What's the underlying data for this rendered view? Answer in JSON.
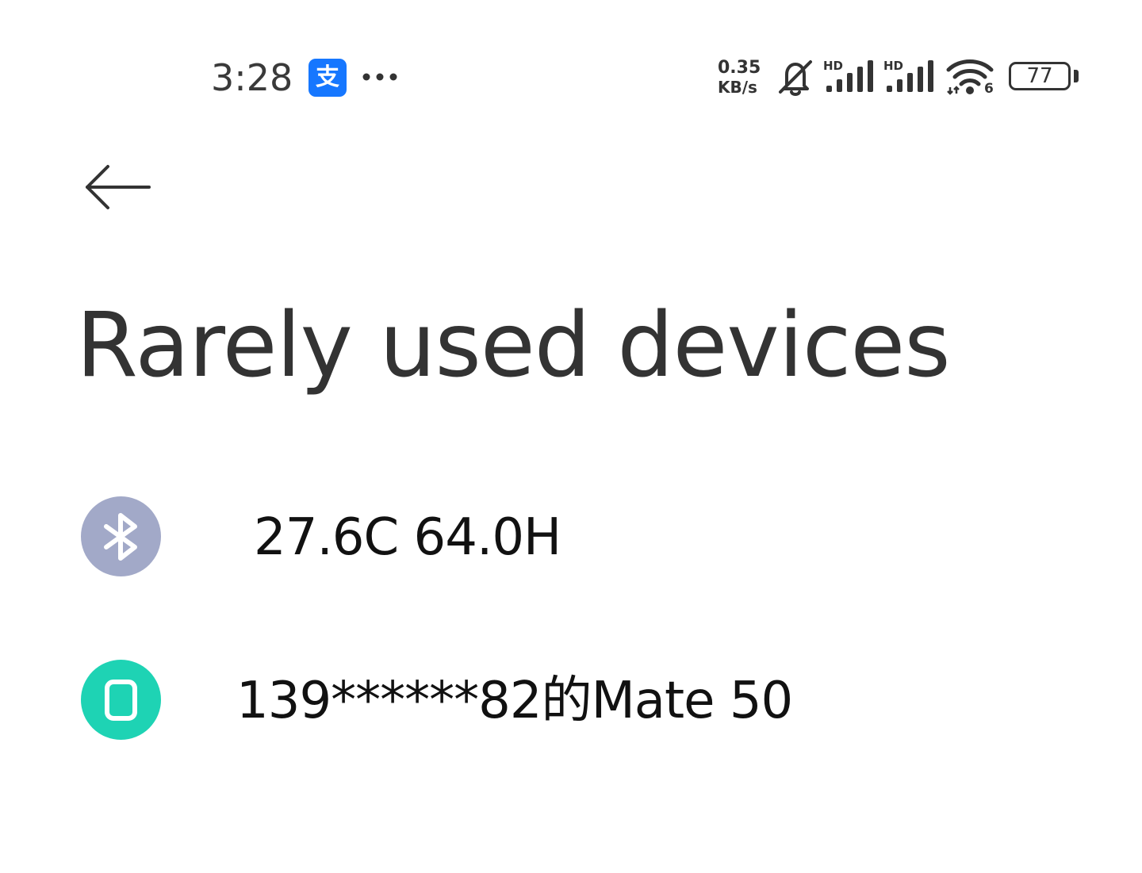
{
  "status_bar": {
    "time": "3:28",
    "notification_icons": [
      "alipay-icon",
      "more-dots-icon"
    ],
    "alipay_glyph": "支",
    "net_speed_value": "0.35",
    "net_speed_unit": "KB/s",
    "sim1_label": "HD",
    "sim2_label": "HD",
    "wifi_label": "6",
    "battery_level": "77",
    "icons": [
      "bell-muted-icon",
      "signal-icon",
      "signal-icon",
      "wifi-6-icon",
      "battery-icon"
    ]
  },
  "header": {
    "back_icon": "arrow-left-icon",
    "title": "Rarely used devices"
  },
  "devices": [
    {
      "name": "27.6C 64.0H",
      "icon": "bluetooth-icon",
      "icon_color": "#a2a9c8"
    },
    {
      "name": "139******82的Mate 50",
      "icon": "phone-icon",
      "icon_color": "#1ed3b4"
    }
  ],
  "colors": {
    "background": "#ffffff",
    "title_text": "#333333",
    "item_text": "#111111",
    "alipay_blue": "#1677ff"
  }
}
